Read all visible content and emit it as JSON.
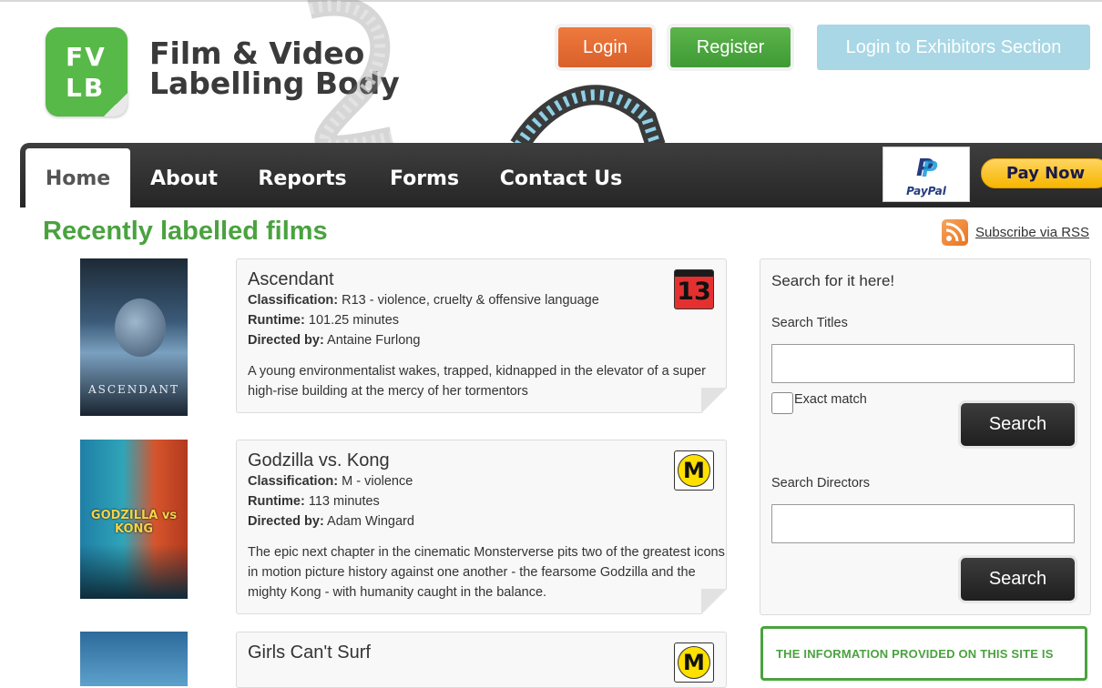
{
  "header": {
    "logo_line1": "FV",
    "logo_line2": "LB",
    "brand_line1": "Film & Video",
    "brand_line2": "Labelling Body",
    "login_label": "Login",
    "register_label": "Register",
    "exhibitors_label": "Login to Exhibitors Section"
  },
  "nav": {
    "items": [
      "Home",
      "About",
      "Reports",
      "Forms",
      "Contact Us"
    ],
    "active": "Home",
    "paypal_word": "PayPal",
    "paypal_glyph": "P",
    "pay_now_label": "Pay Now"
  },
  "main": {
    "title": "Recently labelled films",
    "rss_label": "Subscribe via RSS",
    "labels": {
      "classification": "Classification:",
      "runtime": "Runtime:",
      "directed_by": "Directed by:"
    },
    "films": [
      {
        "title": "Ascendant",
        "classification": "R13 - violence, cruelty & offensive language",
        "runtime": "101.25 minutes",
        "director": "Antaine Furlong",
        "description": "A young environmentalist wakes, trapped, kidnapped in the elevator of a super high-rise building at the mercy of her tormentors",
        "badge": "13",
        "poster_title": "ASCENDANT"
      },
      {
        "title": "Godzilla vs. Kong",
        "classification": "M - violence",
        "runtime": "113 minutes",
        "director": "Adam Wingard",
        "description": "The epic next chapter in the cinematic Monsterverse pits two of the greatest icons in motion picture history against one another - the fearsome Godzilla and the mighty Kong - with humanity caught in the balance.",
        "badge": "M",
        "poster_title": "GODZILLA vs KONG"
      },
      {
        "title": "Girls Can't Surf",
        "badge": "M"
      }
    ]
  },
  "sidebar": {
    "heading": "Search for it here!",
    "titles_label": "Search Titles",
    "exact_match_label": "Exact match",
    "search_button": "Search",
    "directors_label": "Search Directors",
    "info_text": "THE INFORMATION PROVIDED ON THIS SITE IS"
  },
  "colors": {
    "brand_green": "#4aa23f",
    "login_orange": "#e06a30",
    "register_green": "#4fa83e",
    "exhibitors_blue": "#a9d7e5",
    "nav_dark": "#2f2f2f",
    "paynow_yellow": "#f7b600"
  },
  "icons": {
    "rss": "rss-icon",
    "paypal": "paypal-logo-icon",
    "film_reel": "film-strip-icon"
  }
}
